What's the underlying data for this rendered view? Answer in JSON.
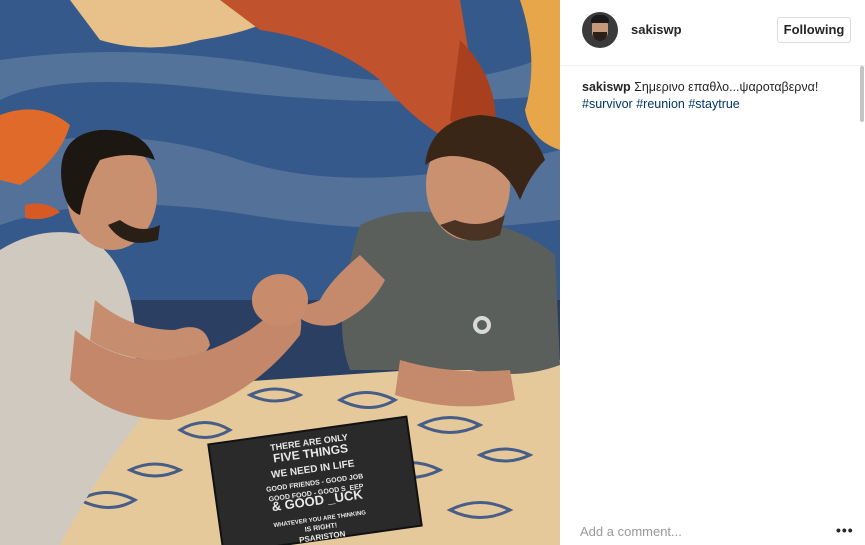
{
  "post": {
    "username": "sakiswp",
    "follow_label": "Following",
    "caption": {
      "username": "sakiswp",
      "text": "Σημερινο επαθλο...ψαροταβερνα!",
      "hashtags": [
        "#survivor",
        "#reunion",
        "#staytrue"
      ]
    },
    "comment_placeholder": "Add a comment...",
    "more_label": "•••"
  },
  "photo": {
    "sign_lines": [
      "THERE ARE ONLY",
      "FIVE THINGS",
      "WE NEED IN LIFE",
      "GOOD FRIENDS - GOOD JOB",
      "GOOD FOOD - GOOD S_EEP",
      "& GOOD _UCK",
      "WHATEVER YOU ARE THINKING",
      "IS RIGHT!",
      "PSARISTON"
    ]
  }
}
